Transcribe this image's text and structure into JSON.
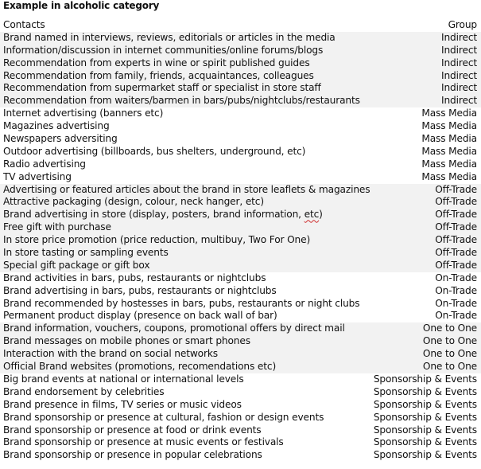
{
  "title": "Example in alcoholic category",
  "table": {
    "headers": {
      "contacts": "Contacts",
      "group": "Group"
    },
    "rows": [
      {
        "contact": "Brand named in interviews, reviews, editorials or articles in the media",
        "group": "Indirect"
      },
      {
        "contact": "Information/discussion in internet communities/online forums/blogs",
        "group": "Indirect"
      },
      {
        "contact": "Recommendation from experts in wine or spirit published guides",
        "group": "Indirect"
      },
      {
        "contact": "Recommendation from family, friends, acquaintances, colleagues",
        "group": "Indirect"
      },
      {
        "contact": "Recommendation from supermarket staff or specialist in store staff",
        "group": "Indirect"
      },
      {
        "contact": "Recommendation from waiters/barmen in bars/pubs/nightclubs/restaurants",
        "group": "Indirect"
      },
      {
        "contact": "Internet advertising (banners etc)",
        "group": "Mass Media"
      },
      {
        "contact": "Magazines advertising",
        "group": "Mass Media"
      },
      {
        "contact": "Newspapers adversiting",
        "group": "Mass Media"
      },
      {
        "contact": "Outdoor advertising (billboards, bus shelters, underground, etc)",
        "group": "Mass Media"
      },
      {
        "contact": "Radio advertising",
        "group": "Mass Media"
      },
      {
        "contact": "TV advertising",
        "group": "Mass Media"
      },
      {
        "contact": "Advertising or featured articles about the brand in store leaflets & magazines",
        "group": "Off-Trade"
      },
      {
        "contact": "Attractive packaging (design, colour, neck hanger, etc)",
        "group": "Off-Trade"
      },
      {
        "contact": "Brand advertising in store (display, posters, brand information, ",
        "contact_suffix_flagged": "etc",
        "contact_tail": ")",
        "group": "Off-Trade"
      },
      {
        "contact": "Free gift with purchase",
        "group": "Off-Trade"
      },
      {
        "contact": "In store price promotion (price reduction, multibuy, Two For One)",
        "group": "Off-Trade"
      },
      {
        "contact": "In store tasting or sampling events",
        "group": "Off-Trade"
      },
      {
        "contact": "Special gift package or gift box",
        "group": "Off-Trade"
      },
      {
        "contact": "Brand activities in bars, pubs, restaurants or nightclubs",
        "group": "On-Trade"
      },
      {
        "contact": "Brand advertising in bars, pubs, restaurants or nightclubs",
        "group": "On-Trade"
      },
      {
        "contact": "Brand recommended by hostesses in bars, pubs, restaurants or night clubs",
        "group": "On-Trade"
      },
      {
        "contact": "Permanent product display (presence on back wall of bar)",
        "group": "On-Trade"
      },
      {
        "contact": "Brand information, vouchers, coupons, promotional offers by direct mail",
        "group": "One to One"
      },
      {
        "contact": "Brand messages on mobile phones or smart phones",
        "group": "One to One"
      },
      {
        "contact": "Interaction with the brand on social networks",
        "group": "One to One"
      },
      {
        "contact": "Official Brand websites (promotions, recomendations etc)",
        "group": "One to One"
      },
      {
        "contact": "Big brand events at national or international levels",
        "group": "Sponsorship & Events"
      },
      {
        "contact": "Brand endorsement by celebrities",
        "group": "Sponsorship & Events"
      },
      {
        "contact": "Brand presence in films, TV series or music videos",
        "group": "Sponsorship & Events"
      },
      {
        "contact": "Brand sponsorship or presence at cultural, fashion or design events",
        "group": "Sponsorship & Events"
      },
      {
        "contact": "Brand sponsorship or presence at food or drink events",
        "group": "Sponsorship & Events"
      },
      {
        "contact": "Brand sponsorship or presence at music events or festivals",
        "group": "Sponsorship & Events"
      },
      {
        "contact": "Brand sponsorship or presence in popular celebrations",
        "group": "Sponsorship & Events"
      }
    ]
  },
  "colors": {
    "shaded_row": "#f2f2f2",
    "text": "#111111",
    "spellcheck_underline": "#d03030"
  },
  "shaded_groups": [
    "Indirect",
    "Off-Trade",
    "One to One"
  ]
}
